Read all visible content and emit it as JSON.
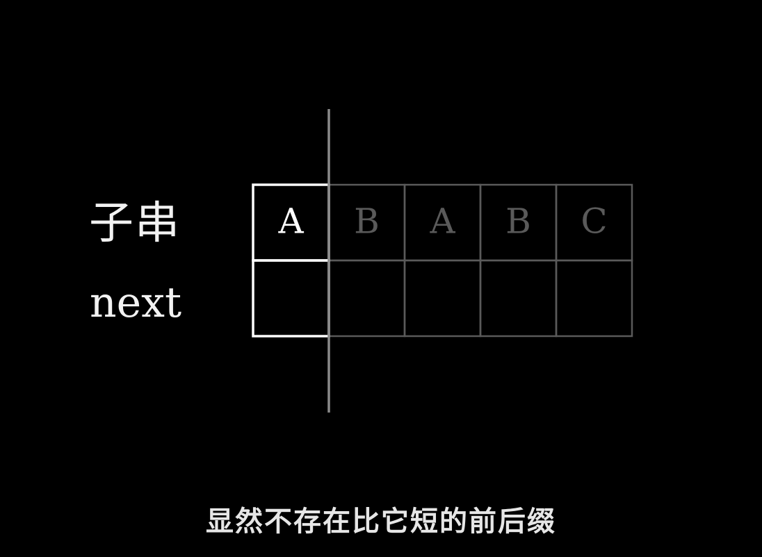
{
  "labels": {
    "substring": "子串",
    "next": "next"
  },
  "cells": [
    "A",
    "B",
    "A",
    "B",
    "C"
  ],
  "cell_states": [
    "active",
    "dim",
    "dim",
    "dim",
    "dim"
  ],
  "next_values": [
    "",
    "",
    "",
    "",
    ""
  ],
  "divider_after_cell": 1,
  "subtitle": "显然不存在比它短的前后缀",
  "colors": {
    "background": "#000000",
    "active": "#ffffff",
    "dim": "#5a5a5a",
    "divider": "#8a8a8a",
    "subtitle": "#e6e6e6"
  }
}
